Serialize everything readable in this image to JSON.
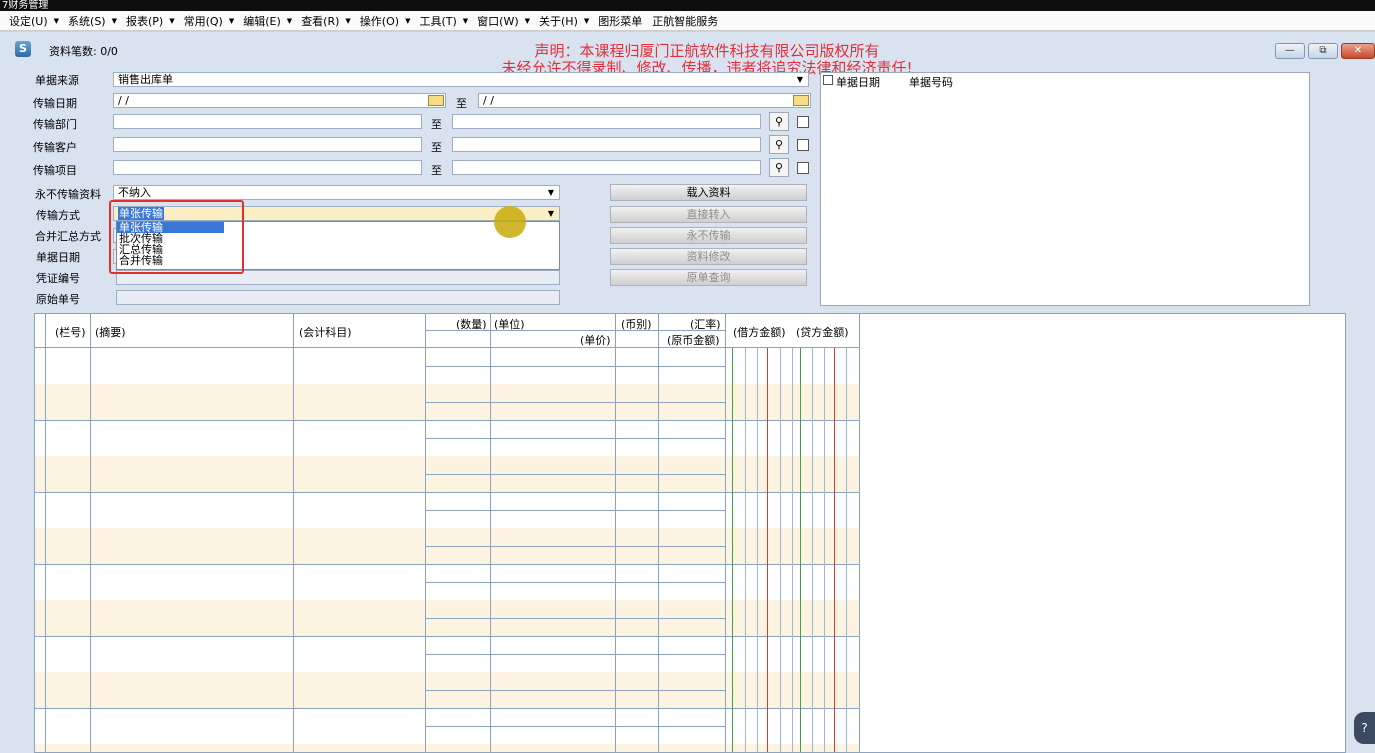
{
  "app_title": "7财务管理",
  "menu": [
    "设定(U)",
    "系统(S)",
    "报表(P)",
    "常用(Q)",
    "编辑(E)",
    "查看(R)",
    "操作(O)",
    "工具(T)",
    "窗口(W)",
    "关于(H)",
    "图形菜单",
    "正航智能服务"
  ],
  "window": {
    "title": "资料笔数: 0/0",
    "notice_line1": "声明：本课程归厦门正航软件科技有限公司版权所有",
    "notice_line2": "未经允许不得录制、修改、传播，违者将追究法律和经济责任!",
    "btn_min": "—",
    "btn_restore": "⧉",
    "btn_close": "✕"
  },
  "form": {
    "source_label": "单据来源",
    "source_value": "销售出库单",
    "date_label": "传输日期",
    "date_from": "  /  /",
    "date_to": "  /  /",
    "to": "至",
    "dept_label": "传输部门",
    "customer_label": "传输客户",
    "project_label": "传输项目",
    "never_label": "永不传输资料",
    "never_value": "不纳入",
    "method_label": "传输方式",
    "method_value": "单张传输",
    "merge_label": "合并汇总方式",
    "doc_date_label": "单据日期",
    "voucher_label": "凭证编号",
    "orig_label": "原始单号"
  },
  "dropdown_options": [
    "单张传输",
    "批次传输",
    "汇总传输",
    "合并传输"
  ],
  "actions": {
    "load": "载入资料",
    "direct": "直接转入",
    "never": "永不传输",
    "modify": "资料修改",
    "query": "原单查询"
  },
  "right_panel": {
    "col_date": "单据日期",
    "col_no": "单据号码"
  },
  "grid_headers": {
    "row_no": "(栏号)",
    "summary": "(摘要)",
    "account": "(会计科目)",
    "qty": "(数量)",
    "unit": "(单位)",
    "price": "(单价)",
    "currency": "(币别)",
    "rate": "(汇率)",
    "orig_amount": "(原币金额)",
    "debit": "(借方金额)",
    "credit": "(贷方金额)"
  },
  "help_icon": "?"
}
